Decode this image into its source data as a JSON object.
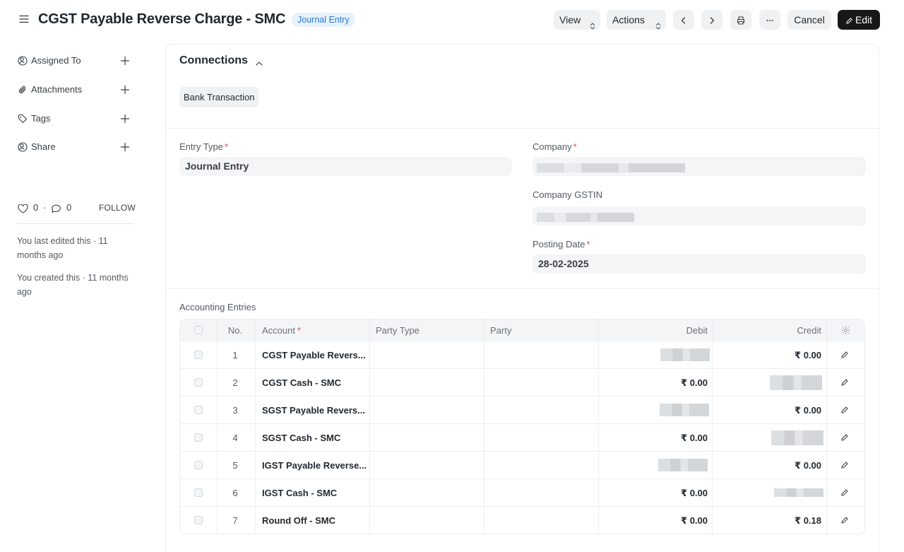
{
  "header": {
    "title": "CGST Payable Reverse Charge - SMC",
    "doc_type_badge": "Journal Entry",
    "view_label": "View",
    "actions_label": "Actions",
    "cancel_label": "Cancel",
    "edit_label": "Edit"
  },
  "sidebar": {
    "items": [
      {
        "label": "Assigned To",
        "icon": "assign-icon"
      },
      {
        "label": "Attachments",
        "icon": "paperclip-icon"
      },
      {
        "label": "Tags",
        "icon": "tag-icon"
      },
      {
        "label": "Share",
        "icon": "share-icon"
      }
    ],
    "like_count": "0",
    "separator": "·",
    "comment_count": "0",
    "follow_label": "FOLLOW",
    "last_edited": "You last edited this · 11 months ago",
    "created": "You created this · 11 months ago"
  },
  "connections": {
    "title": "Connections",
    "chip": "Bank Transaction"
  },
  "form": {
    "entry_type_label": "Entry Type",
    "entry_type_value": "Journal Entry",
    "company_label": "Company",
    "company_gstin_label": "Company GSTIN",
    "posting_date_label": "Posting Date",
    "posting_date_value": "28-02-2025",
    "required_mark": "*"
  },
  "accounting": {
    "section_label": "Accounting Entries",
    "columns": {
      "no": "No.",
      "account": "Account",
      "party_type": "Party Type",
      "party": "Party",
      "debit": "Debit",
      "credit": "Credit"
    },
    "rows": [
      {
        "no": "1",
        "account": "CGST Payable Revers...",
        "debit": "",
        "credit": "₹ 0.00"
      },
      {
        "no": "2",
        "account": "CGST Cash - SMC",
        "debit": "₹ 0.00",
        "credit": ""
      },
      {
        "no": "3",
        "account": "SGST Payable Revers...",
        "debit": "",
        "credit": "₹ 0.00"
      },
      {
        "no": "4",
        "account": "SGST Cash - SMC",
        "debit": "₹ 0.00",
        "credit": ""
      },
      {
        "no": "5",
        "account": "IGST Payable Reverse...",
        "debit": "",
        "credit": "₹ 0.00"
      },
      {
        "no": "6",
        "account": "IGST Cash - SMC",
        "debit": "₹ 0.00",
        "credit": ""
      },
      {
        "no": "7",
        "account": "Round Off - SMC",
        "debit": "₹ 0.00",
        "credit": "₹ 0.18"
      }
    ]
  },
  "colors": {
    "badge_bg": "#e6f2fd",
    "badge_text": "#2b78d5",
    "edit_button_bg": "#171717",
    "required": "#e24c4c"
  }
}
